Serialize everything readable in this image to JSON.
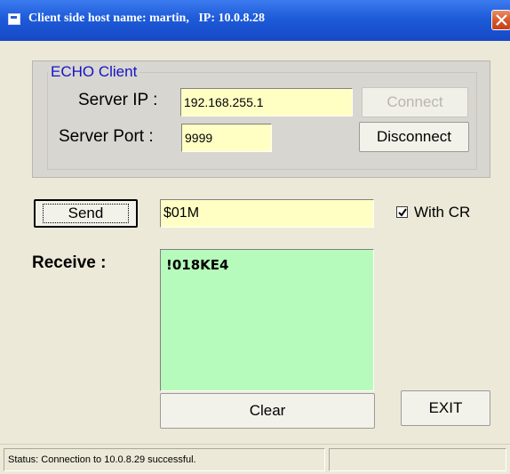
{
  "window": {
    "title": "Client side host name: martin,   IP: 10.0.8.28"
  },
  "echo_group": {
    "legend": "ECHO  Client",
    "server_ip_label": "Server IP :",
    "server_ip_value": "192.168.255.1",
    "server_port_label": "Server Port :",
    "server_port_value": "9999",
    "connect_label": "Connect",
    "disconnect_label": "Disconnect"
  },
  "send": {
    "button_label": "Send",
    "command_value": "$01M",
    "with_cr_label": "With CR",
    "with_cr_checked": true
  },
  "receive": {
    "label": "Receive :",
    "text": "!018KE4"
  },
  "actions": {
    "clear_label": "Clear",
    "exit_label": "EXIT"
  },
  "status": {
    "text": "Status: Connection to 10.0.8.29 successful."
  },
  "colors": {
    "titlebar": "#1d5bd8",
    "legend": "#1414c8",
    "input_bg": "#ffffc4",
    "receive_bg": "#b6fbbb",
    "window_bg": "#ece9d8"
  }
}
